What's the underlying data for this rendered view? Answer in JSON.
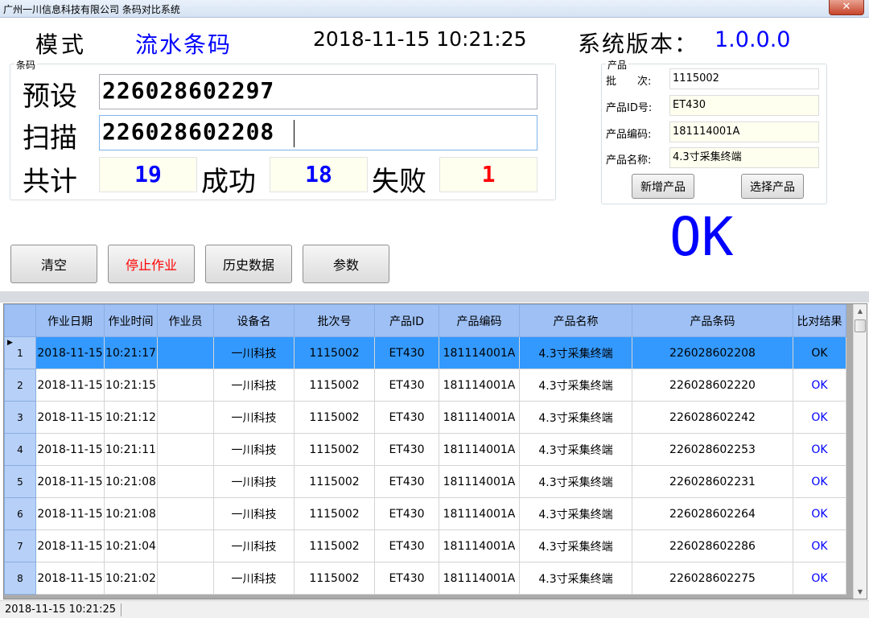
{
  "window": {
    "title": "广州一川信息科技有限公司 条码对比系统",
    "close_glyph": "✕"
  },
  "header": {
    "mode_label": "模式",
    "mode_value": "流水条码",
    "datetime": "2018-11-15 10:21:25",
    "version_label": "系统版本：",
    "version_value": "1.0.0.0"
  },
  "barcode_group": {
    "label": "条码",
    "preset_label": "预设",
    "preset_value": "226028602297",
    "scan_label": "扫描",
    "scan_value": "226028602208",
    "total_label": "共计",
    "total_value": "19",
    "success_label": "成功",
    "success_value": "18",
    "fail_label": "失败",
    "fail_value": "1"
  },
  "product_group": {
    "label": "产品",
    "batch_label": "批　　次:",
    "batch_value": "1115002",
    "id_label": "产品ID号:",
    "id_value": "ET430",
    "code_label": "产品编码:",
    "code_value": "181114001A",
    "name_label": "产品名称:",
    "name_value": "4.3寸采集终端",
    "add_button": "新增产品",
    "select_button": "选择产品"
  },
  "result": {
    "text": "OK"
  },
  "toolbar": {
    "clear": "清空",
    "stop": "停止作业",
    "history": "历史数据",
    "params": "参数"
  },
  "colors": {
    "mode_value": "#0000ff",
    "version_value": "#0000ff",
    "count_value": "#0000ff",
    "fail_value": "#ff0000",
    "stop_button_text": "#ff0000",
    "ok_text": "#0000ff",
    "grid_header": "#9ec0f5",
    "grid_selected": "#3399ff"
  },
  "table": {
    "columns": [
      "作业日期",
      "作业时间",
      "作业员",
      "设备名",
      "批次号",
      "产品ID",
      "产品编码",
      "产品名称",
      "产品条码",
      "比对结果"
    ],
    "rows": [
      {
        "n": "1",
        "date": "2018-11-15",
        "time": "10:21:17",
        "operator": "",
        "device": "一川科技",
        "batch": "1115002",
        "pid": "ET430",
        "pcode": "181114001A",
        "pname": "4.3寸采集终端",
        "barcode": "226028602208",
        "result": "OK"
      },
      {
        "n": "2",
        "date": "2018-11-15",
        "time": "10:21:15",
        "operator": "",
        "device": "一川科技",
        "batch": "1115002",
        "pid": "ET430",
        "pcode": "181114001A",
        "pname": "4.3寸采集终端",
        "barcode": "226028602220",
        "result": "OK"
      },
      {
        "n": "3",
        "date": "2018-11-15",
        "time": "10:21:12",
        "operator": "",
        "device": "一川科技",
        "batch": "1115002",
        "pid": "ET430",
        "pcode": "181114001A",
        "pname": "4.3寸采集终端",
        "barcode": "226028602242",
        "result": "OK"
      },
      {
        "n": "4",
        "date": "2018-11-15",
        "time": "10:21:11",
        "operator": "",
        "device": "一川科技",
        "batch": "1115002",
        "pid": "ET430",
        "pcode": "181114001A",
        "pname": "4.3寸采集终端",
        "barcode": "226028602253",
        "result": "OK"
      },
      {
        "n": "5",
        "date": "2018-11-15",
        "time": "10:21:08",
        "operator": "",
        "device": "一川科技",
        "batch": "1115002",
        "pid": "ET430",
        "pcode": "181114001A",
        "pname": "4.3寸采集终端",
        "barcode": "226028602231",
        "result": "OK"
      },
      {
        "n": "6",
        "date": "2018-11-15",
        "time": "10:21:08",
        "operator": "",
        "device": "一川科技",
        "batch": "1115002",
        "pid": "ET430",
        "pcode": "181114001A",
        "pname": "4.3寸采集终端",
        "barcode": "226028602264",
        "result": "OK"
      },
      {
        "n": "7",
        "date": "2018-11-15",
        "time": "10:21:04",
        "operator": "",
        "device": "一川科技",
        "batch": "1115002",
        "pid": "ET430",
        "pcode": "181114001A",
        "pname": "4.3寸采集终端",
        "barcode": "226028602286",
        "result": "OK"
      },
      {
        "n": "8",
        "date": "2018-11-15",
        "time": "10:21:02",
        "operator": "",
        "device": "一川科技",
        "batch": "1115002",
        "pid": "ET430",
        "pcode": "181114001A",
        "pname": "4.3寸采集终端",
        "barcode": "226028602275",
        "result": "OK"
      }
    ],
    "selected_row_marker": "▶"
  },
  "statusbar": {
    "text": "2018-11-15 10:21:25"
  }
}
